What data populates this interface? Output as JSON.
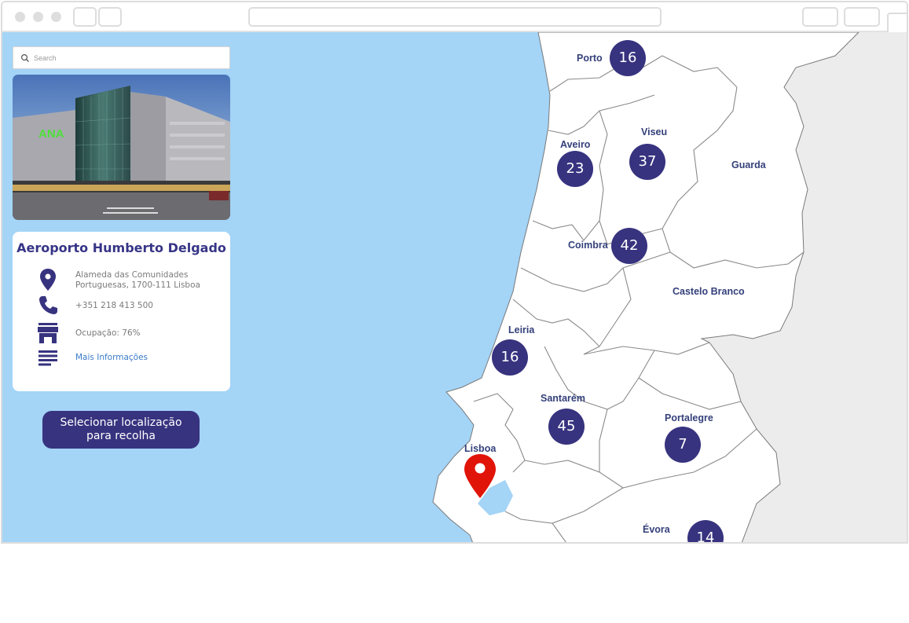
{
  "search": {
    "placeholder": "Search",
    "value": ""
  },
  "photo": {
    "signage": "ANA",
    "alt": ""
  },
  "location": {
    "title": "Aeroporto Humberto Delgado",
    "address_line1": "Alameda das Comunidades",
    "address_line2": "Portuguesas, 1700-111 Lisboa",
    "phone": "+351 218 413 500",
    "occupancy": "Ocupação: 76%",
    "more_info": "Mais Informações",
    "icons": [
      "location-pin-icon",
      "phone-icon",
      "store-icon",
      "text-lines-icon"
    ]
  },
  "select_button": {
    "line1": "Selecionar localização",
    "line2": "para recolha"
  },
  "map": {
    "districts": {
      "porto": "Porto",
      "aveiro": "Aveiro",
      "viseu": "Viseu",
      "guarda": "Guarda",
      "coimbra": "Coimbra",
      "castelo_branco": "Castelo Branco",
      "leiria": "Leiria",
      "santarem": "Santarém",
      "portalegre": "Portalegre",
      "lisboa": "Lisboa",
      "evora": "Évora"
    },
    "clusters": {
      "porto": "16",
      "aveiro": "23",
      "viseu": "37",
      "coimbra": "42",
      "leiria": "16",
      "santarem": "45",
      "portalegre": "7",
      "evora": "14"
    },
    "selected_marker": "Lisboa",
    "colors": {
      "sea": "#a4d4f6",
      "land": "#ffffff",
      "spain": "#ececec",
      "cluster": "#37337f",
      "pin": "#e1140a",
      "label": "#34407a"
    }
  }
}
